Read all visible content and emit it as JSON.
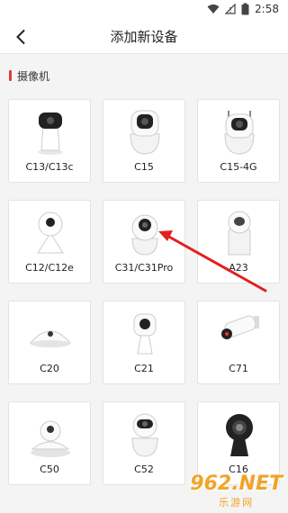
{
  "status_bar": {
    "time": "2:58"
  },
  "header": {
    "title": "添加新设备"
  },
  "section": {
    "title": "摄像机",
    "accent_color": "#e53935"
  },
  "devices": [
    {
      "name": "C13/C13c",
      "icon": "camera-c13-icon"
    },
    {
      "name": "C15",
      "icon": "camera-c15-icon"
    },
    {
      "name": "C15-4G",
      "icon": "camera-c15-4g-icon"
    },
    {
      "name": "C12/C12e",
      "icon": "camera-c12-icon"
    },
    {
      "name": "C31/C31Pro",
      "icon": "camera-c31-icon"
    },
    {
      "name": "A23",
      "icon": "camera-a23-icon"
    },
    {
      "name": "C20",
      "icon": "camera-c20-icon"
    },
    {
      "name": "C21",
      "icon": "camera-c21-icon"
    },
    {
      "name": "C71",
      "icon": "camera-c71-icon"
    },
    {
      "name": "C50",
      "icon": "camera-c50-icon"
    },
    {
      "name": "C52",
      "icon": "camera-c52-icon"
    },
    {
      "name": "C16",
      "icon": "camera-c16-icon"
    }
  ],
  "annotation": {
    "arrow_color": "#e02020"
  },
  "watermark": {
    "main": "962.NET",
    "sub": "乐游网"
  }
}
